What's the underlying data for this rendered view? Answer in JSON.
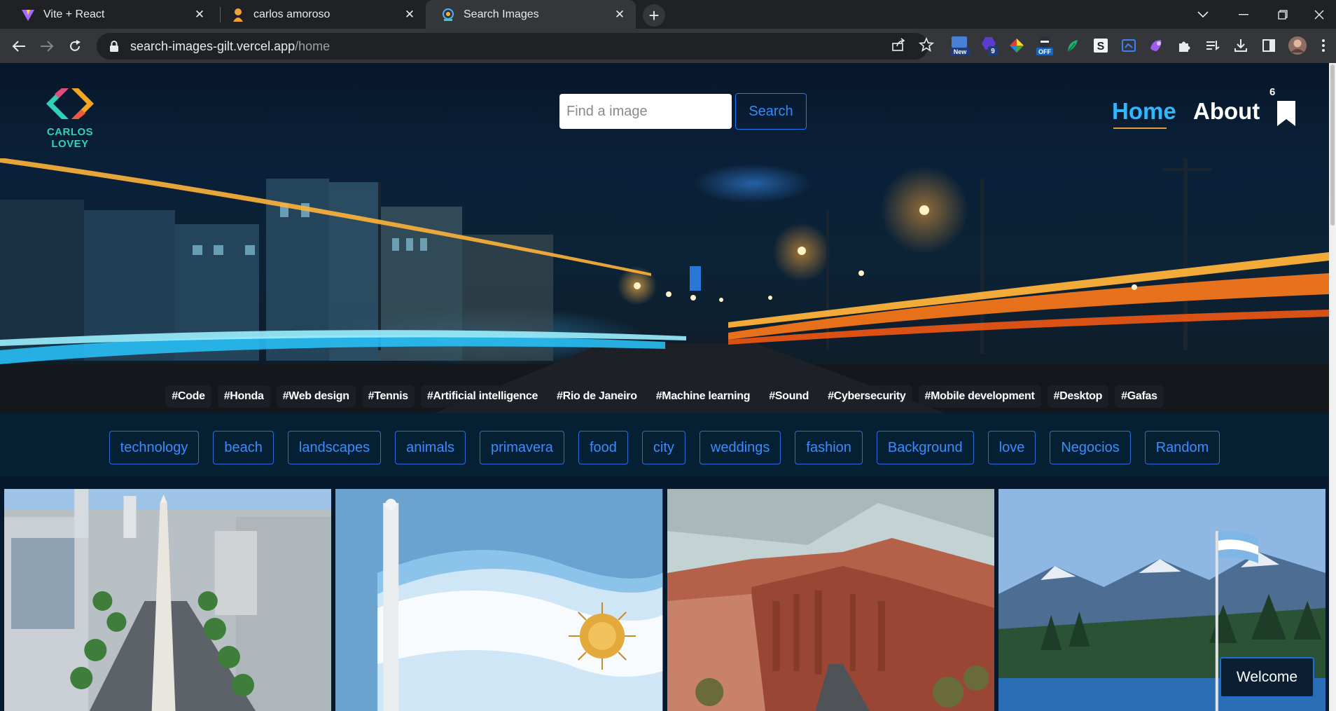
{
  "browser": {
    "tabs": [
      {
        "title": "Vite + React",
        "icon": "vite-icon",
        "active": false
      },
      {
        "title": "carlos amoroso",
        "icon": "person-icon",
        "active": false
      },
      {
        "title": "Search Images",
        "icon": "search-images-icon",
        "active": true
      }
    ],
    "url_host": "search-images-gilt.vercel.app",
    "url_path": "/home",
    "extensions": {
      "new_badge": "New",
      "count_badge": "9",
      "off_badge": "OFF"
    }
  },
  "header": {
    "logo_text": "CARLOS LOVEY",
    "search_placeholder": "Find a image",
    "search_button": "Search",
    "nav": {
      "home": "Home",
      "about": "About"
    },
    "saved_count": "6"
  },
  "hashtags": [
    "#Code",
    "#Honda",
    "#Web design",
    "#Tennis",
    "#Artificial intelligence",
    "#Rio de Janeiro",
    "#Machine learning",
    "#Sound",
    "#Cybersecurity",
    "#Mobile development",
    "#Desktop",
    "#Gafas"
  ],
  "categories": [
    "technology",
    "beach",
    "landscapes",
    "animals",
    "primavera",
    "food",
    "city",
    "weddings",
    "fashion",
    "Background",
    "love",
    "Negocios",
    "Random"
  ],
  "gallery": [
    {
      "subject": "obelisk-avenue"
    },
    {
      "subject": "argentina-flag-obelisk"
    },
    {
      "subject": "red-canyon-road"
    },
    {
      "subject": "mountain-lake-flag"
    }
  ],
  "toast": {
    "welcome": "Welcome"
  },
  "colors": {
    "accent": "#2f8cff",
    "nav_active": "#2fb7ff",
    "underline": "#e79a3a",
    "logo": "#2fd2b8"
  }
}
